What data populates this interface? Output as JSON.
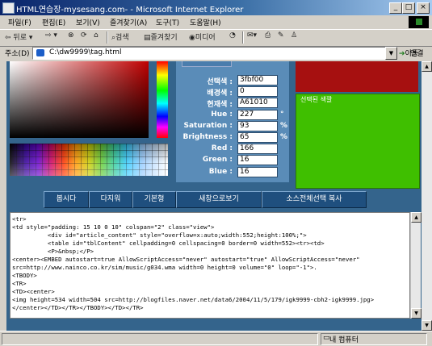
{
  "window": {
    "title": "HTML연습장-mysesang.com- - Microsoft Internet Explorer"
  },
  "menu": [
    "파일(F)",
    "편집(E)",
    "보기(V)",
    "즐겨찾기(A)",
    "도구(T)",
    "도움말(H)"
  ],
  "toolbar": {
    "back": "뒤로",
    "search": "검색",
    "favorites": "즐겨찾기",
    "media": "미디어"
  },
  "address": {
    "label": "주소(D)",
    "value": "C:\\dw9999\\tag.html",
    "go": "이동",
    "links": "연결"
  },
  "picker": {
    "panel_header": "",
    "rows": [
      {
        "label": "선택색 :",
        "value": "3fbf00",
        "unit": ""
      },
      {
        "label": "배경색 :",
        "value": "0",
        "unit": ""
      },
      {
        "label": "현재색 :",
        "value": "A61010",
        "unit": ""
      },
      {
        "label": "Hue :",
        "value": "227",
        "unit": "°"
      },
      {
        "label": "Saturation :",
        "value": "93",
        "unit": "%"
      },
      {
        "label": "Brightness :",
        "value": "65",
        "unit": "%"
      },
      {
        "label": "Red :",
        "value": "166",
        "unit": ""
      },
      {
        "label": "Green :",
        "value": "16",
        "unit": ""
      },
      {
        "label": "Blue :",
        "value": "16",
        "unit": ""
      }
    ],
    "selected_color_label": "선택된 색깔",
    "current_color": "#a61010",
    "selected_color": "#3fbf00"
  },
  "buttons": [
    "봅시다",
    "다지워",
    "기본형",
    "새창으로보기",
    "소스전체선택 복사"
  ],
  "code_text": "<tr>\n<td style=\"padding: 15 10 0 10\" colspan=\"2\" class=\"view\">\n          <div id=\"article_content\" style=\"overflow=x:auto;width:552;height:100%;\">\n          <table id=\"tblContent\" cellpadding=0 cellspacing=0 border=0 width=552><tr><td>\n          <P>&nbsp;</P>\n<center><EMBED autostart=true AllowScriptAccess=\"never\" autostart=\"true\" AllowScriptAccess=\"never\"\nsrc=http://www.nainco.co.kr/sim/music/g034.wma width=0 height=0 volume=\"0\" loop=\"-1\">.\n<TBODY>\n<TR>\n<TD><center>\n<img height=534 width=504 src=http://blogfiles.naver.net/data6/2004/11/5/179/igk9999-cbh2-igk9999.jpg>\n</center></TD></TR></TBODY></TD></TR>",
  "status": {
    "zone": "내 컴퓨터"
  }
}
